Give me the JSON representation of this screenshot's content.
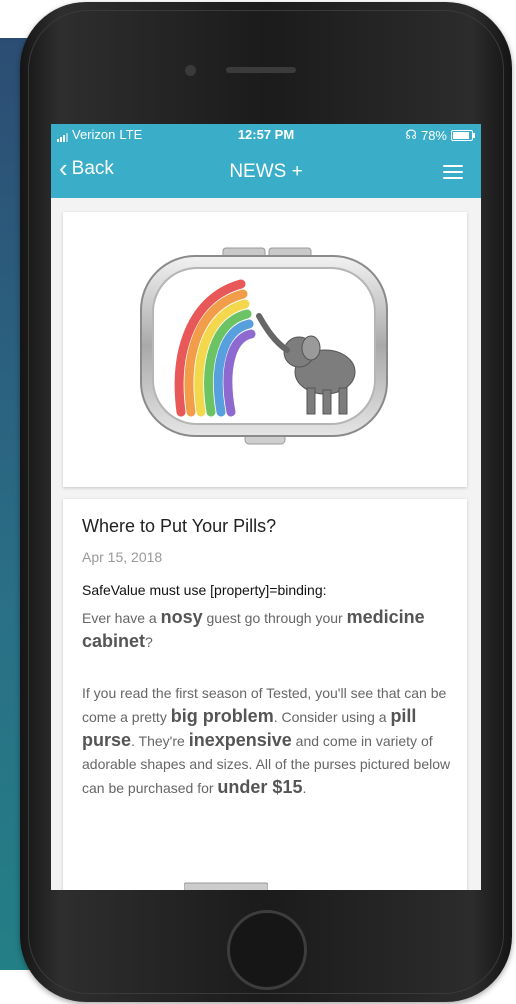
{
  "status_bar": {
    "carrier": "Verizon",
    "network": "LTE",
    "time": "12:57 PM",
    "battery": "78%"
  },
  "navbar": {
    "back_label": "Back",
    "title": "NEWS +"
  },
  "article": {
    "title": "Where to Put Your Pills?",
    "date": "Apr 15, 2018",
    "warning": "SafeValue must use [property]=binding:",
    "p1": {
      "t1": "Ever have a ",
      "b1": "nosy",
      "t2": " guest go through your ",
      "b2": "medicine cabinet",
      "t3": "?"
    },
    "p2": {
      "t1": "If you read the first season of Tested, you'll see that can be come a pretty ",
      "b1": "big problem",
      "t2": ". Consider using a ",
      "b2": "pill purse",
      "t3": ". They're ",
      "b3": "inexpensive",
      "t4": " and come in variety of adorable shapes and sizes.  All of the purses pictured below can be purchased for ",
      "b4": "under $15",
      "t5": "."
    }
  },
  "colors": {
    "accent": "#3aadc8",
    "background_panel": "#2a6f86"
  }
}
